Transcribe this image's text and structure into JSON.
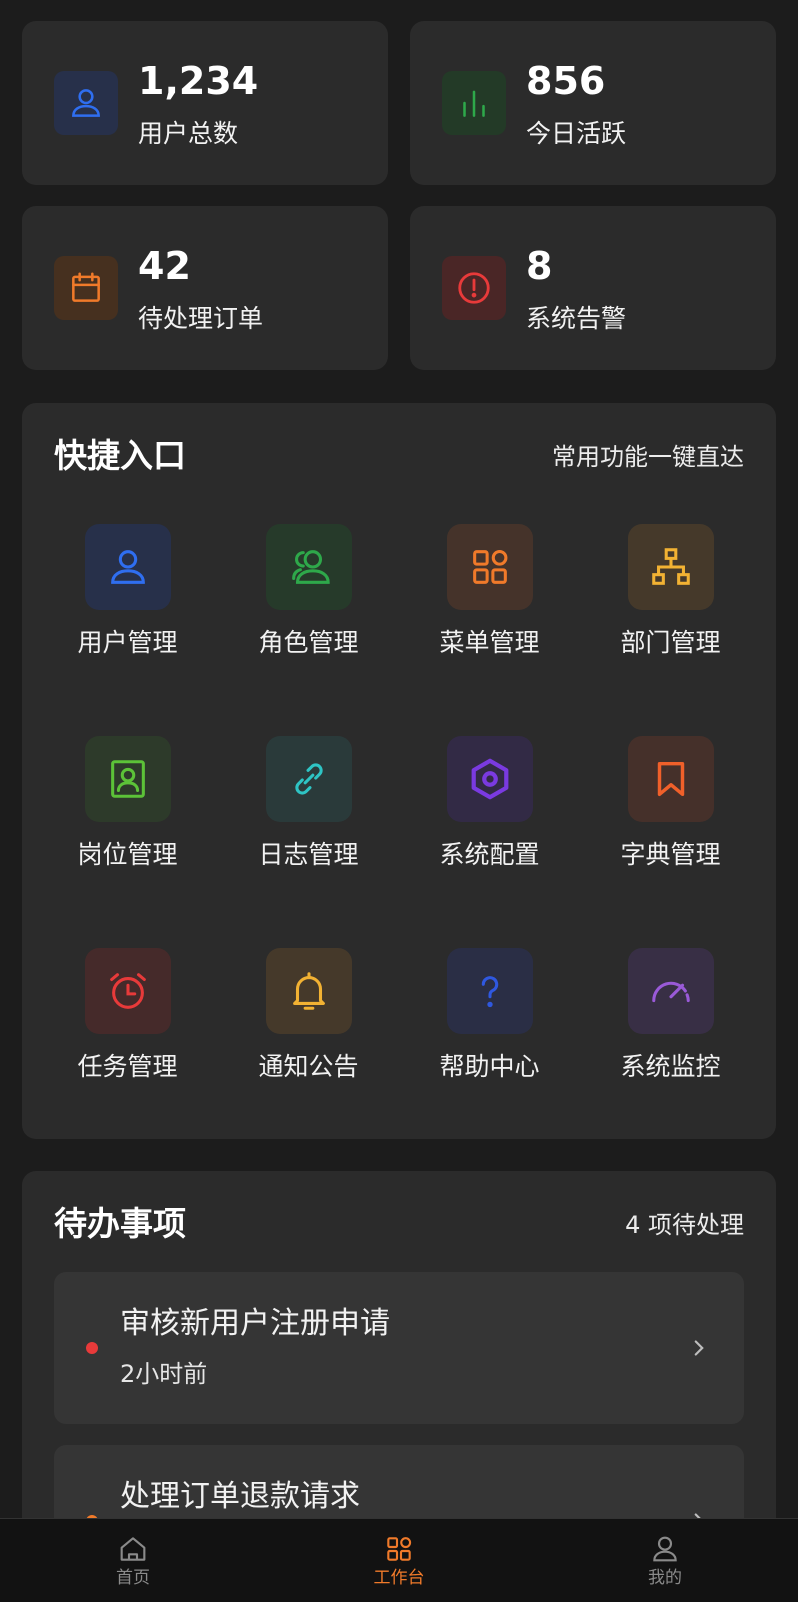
{
  "stats": [
    {
      "value": "1,234",
      "label": "用户总数",
      "icon": "user-icon",
      "color": "#2f6ef0",
      "bg": "#27304a"
    },
    {
      "value": "856",
      "label": "今日活跃",
      "icon": "bar-chart-icon",
      "color": "#2ea84a",
      "bg": "#233a27"
    },
    {
      "value": "42",
      "label": "待处理订单",
      "icon": "calendar-icon",
      "color": "#f07a2a",
      "bg": "#46301f"
    },
    {
      "value": "8",
      "label": "系统告警",
      "icon": "alert-icon",
      "color": "#e83a3a",
      "bg": "#4a2626"
    }
  ],
  "quick": {
    "title": "快捷入口",
    "subtitle": "常用功能一键直达",
    "items": [
      {
        "label": "用户管理",
        "icon": "user-icon",
        "color": "#2f6ef0",
        "bg": "#27304a"
      },
      {
        "label": "角色管理",
        "icon": "users-icon",
        "color": "#2ea84a",
        "bg": "#263a2a"
      },
      {
        "label": "菜单管理",
        "icon": "grid-icon",
        "color": "#f07a2a",
        "bg": "#45332a"
      },
      {
        "label": "部门管理",
        "icon": "org-chart-icon",
        "color": "#f2b233",
        "bg": "#45392a"
      },
      {
        "label": "岗位管理",
        "icon": "badge-icon",
        "color": "#5cc238",
        "bg": "#2d3a2a"
      },
      {
        "label": "日志管理",
        "icon": "link-icon",
        "color": "#2ec4c4",
        "bg": "#2a3a3a"
      },
      {
        "label": "系统配置",
        "icon": "settings-hex-icon",
        "color": "#7a3ae0",
        "bg": "#322a45"
      },
      {
        "label": "字典管理",
        "icon": "bookmark-icon",
        "color": "#f0602a",
        "bg": "#45302a"
      },
      {
        "label": "任务管理",
        "icon": "alarm-icon",
        "color": "#e83a3a",
        "bg": "#452a2a"
      },
      {
        "label": "通知公告",
        "icon": "bell-icon",
        "color": "#f2b233",
        "bg": "#45392a"
      },
      {
        "label": "帮助中心",
        "icon": "help-icon",
        "color": "#2f58e0",
        "bg": "#2a2e45"
      },
      {
        "label": "系统监控",
        "icon": "gauge-icon",
        "color": "#9a5ad8",
        "bg": "#382f45"
      }
    ]
  },
  "todo": {
    "title": "待办事项",
    "subtitle": "4 项待处理",
    "items": [
      {
        "title": "审核新用户注册申请",
        "time": "2小时前",
        "dot_color": "#e83a3a"
      },
      {
        "title": "处理订单退款请求",
        "time": "",
        "dot_color": "#f07a2a"
      }
    ]
  },
  "tabbar": {
    "items": [
      {
        "label": "首页",
        "icon": "home-icon",
        "active": false
      },
      {
        "label": "工作台",
        "icon": "grid-icon",
        "active": true
      },
      {
        "label": "我的",
        "icon": "profile-icon",
        "active": false
      }
    ],
    "active_color": "#f07a2a"
  }
}
